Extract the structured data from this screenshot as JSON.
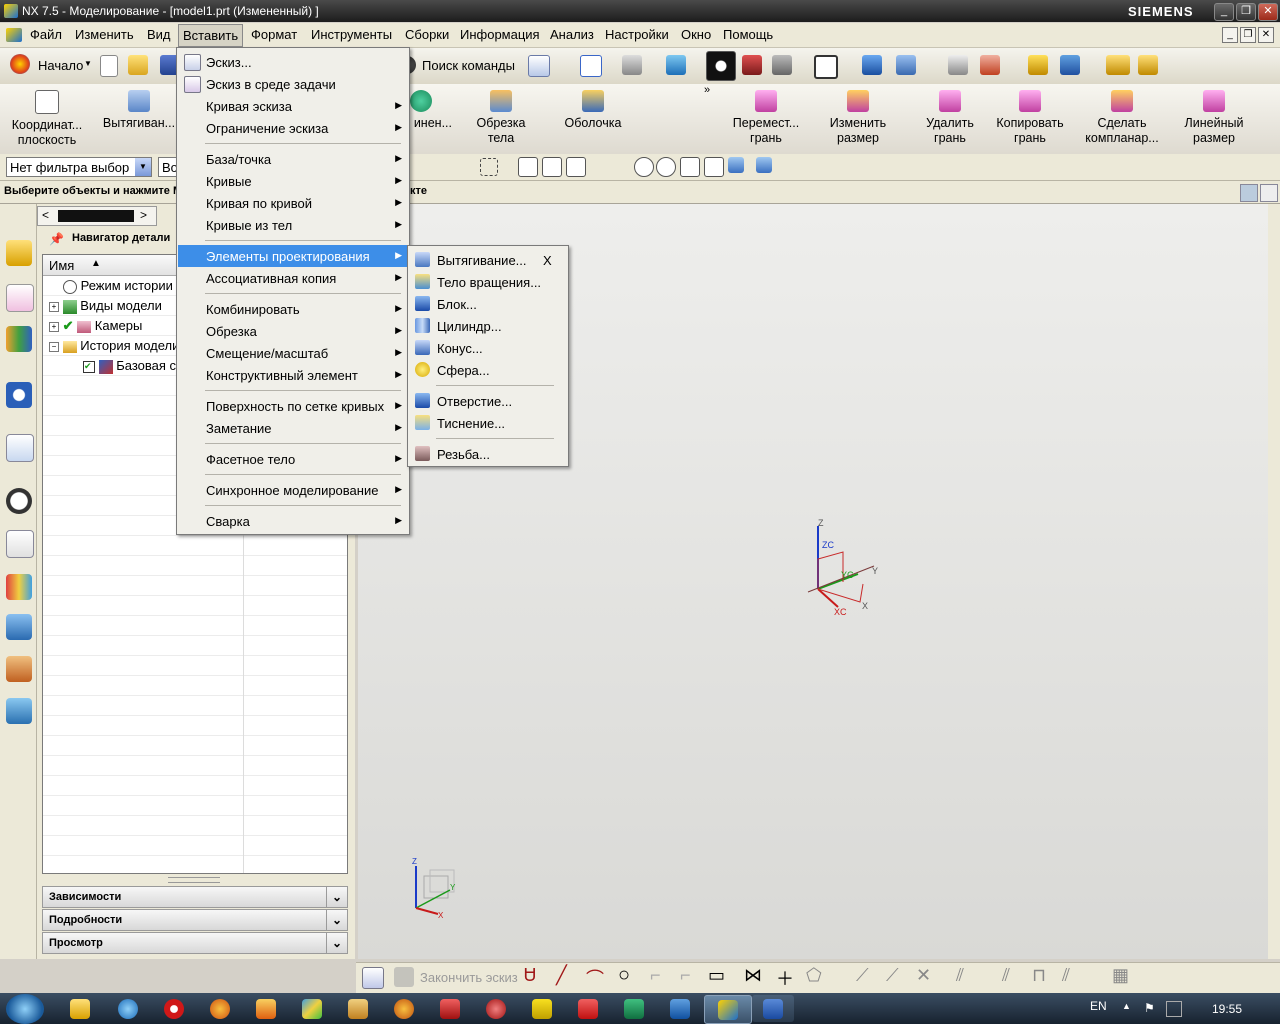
{
  "window": {
    "title": "NX 7.5 - Моделирование - [model1.prt (Измененный) ]",
    "brand": "SIEMENS"
  },
  "menubar": {
    "items": [
      {
        "label": "Файл"
      },
      {
        "label": "Изменить"
      },
      {
        "label": "Вид"
      },
      {
        "label": "Вставить"
      },
      {
        "label": "Формат"
      },
      {
        "label": "Инструменты"
      },
      {
        "label": "Сборки"
      },
      {
        "label": "Информация"
      },
      {
        "label": "Анализ"
      },
      {
        "label": "Настройки"
      },
      {
        "label": "Окно"
      },
      {
        "label": "Помощь"
      }
    ],
    "active": "Вставить"
  },
  "toolbar1": {
    "start_label": "Начало",
    "find_command_label": "Поиск команды"
  },
  "toolbar2": {
    "left_buttons": [
      {
        "line1": "Координат...",
        "line2": "плоскость"
      },
      {
        "line1": "Вытягиван...",
        "line2": ""
      }
    ],
    "mid_buttons": [
      {
        "line1": "инен...",
        "line2": ""
      },
      {
        "line1": "Обрезка",
        "line2": "тела"
      },
      {
        "line1": "Оболочка",
        "line2": ""
      }
    ],
    "right_buttons": [
      {
        "line1": "Перемест...",
        "line2": "грань"
      },
      {
        "line1": "Изменить",
        "line2": "размер"
      },
      {
        "line1": "Удалить",
        "line2": "грань"
      },
      {
        "line1": "Копировать",
        "line2": "грань"
      },
      {
        "line1": "Сделать",
        "line2": "компланар..."
      },
      {
        "line1": "Линейный",
        "line2": "размер"
      }
    ]
  },
  "selection_bar": {
    "filter_value": "Нет фильтра выбор",
    "scope_value": "Во"
  },
  "cue_line": {
    "text": "Выберите объекты и нажмите М",
    "tail": "кте"
  },
  "navigator": {
    "title": "Навигатор детали",
    "column_name": "Имя",
    "nodes": [
      {
        "label": "Режим истории"
      },
      {
        "label": "Виды модели"
      },
      {
        "label": "Камеры"
      },
      {
        "label": "История модели"
      },
      {
        "label": "Базовая с"
      }
    ],
    "panels": [
      "Зависимости",
      "Подробности",
      "Просмотр"
    ]
  },
  "insert_menu": {
    "items": [
      {
        "label": "Эскиз...",
        "sub": false
      },
      {
        "label": "Эскиз в среде задачи",
        "sub": false
      },
      {
        "label": "Кривая эскиза",
        "sub": true
      },
      {
        "label": "Ограничение эскиза",
        "sub": true
      },
      {
        "label": "База/точка",
        "sub": true
      },
      {
        "label": "Кривые",
        "sub": true
      },
      {
        "label": "Кривая по кривой",
        "sub": true
      },
      {
        "label": "Кривые из тел",
        "sub": true
      },
      {
        "label": "Элементы проектирования",
        "sub": true
      },
      {
        "label": "Ассоциативная копия",
        "sub": true
      },
      {
        "label": "Комбинировать",
        "sub": true
      },
      {
        "label": "Обрезка",
        "sub": true
      },
      {
        "label": "Смещение/масштаб",
        "sub": true
      },
      {
        "label": "Конструктивный элемент",
        "sub": true
      },
      {
        "label": "Поверхность по сетке кривых",
        "sub": true
      },
      {
        "label": "Заметание",
        "sub": true
      },
      {
        "label": "Фасетное тело",
        "sub": true
      },
      {
        "label": "Синхронное моделирование",
        "sub": true
      },
      {
        "label": "Сварка",
        "sub": true
      }
    ],
    "highlighted": "Элементы проектирования"
  },
  "design_features_menu": {
    "items": [
      {
        "label": "Вытягивание...",
        "shortcut": "X"
      },
      {
        "label": "Тело вращения...",
        "shortcut": ""
      },
      {
        "label": "Блок...",
        "shortcut": ""
      },
      {
        "label": "Цилиндр...",
        "shortcut": ""
      },
      {
        "label": "Конус...",
        "shortcut": ""
      },
      {
        "label": "Сфера...",
        "shortcut": ""
      },
      {
        "label": "Отверстие...",
        "shortcut": ""
      },
      {
        "label": "Тиснение...",
        "shortcut": ""
      },
      {
        "label": "Резьба...",
        "shortcut": ""
      }
    ]
  },
  "graphics": {
    "csys_labels": {
      "z": "Z",
      "zc": "ZC",
      "y": "Y",
      "yc": "YC",
      "x": "X",
      "xc": "XC"
    },
    "triad_labels": {
      "z": "Z",
      "y": "Y",
      "x": "X"
    }
  },
  "sketch_toolbar": {
    "finish_label": "Закончить эскиз"
  },
  "taskbar": {
    "lang": "EN",
    "time": "19:55"
  },
  "colors": {
    "highlight": "#3d8ee8",
    "menu_bg": "#f0efe9",
    "panel_bg": "#ece9d8"
  }
}
